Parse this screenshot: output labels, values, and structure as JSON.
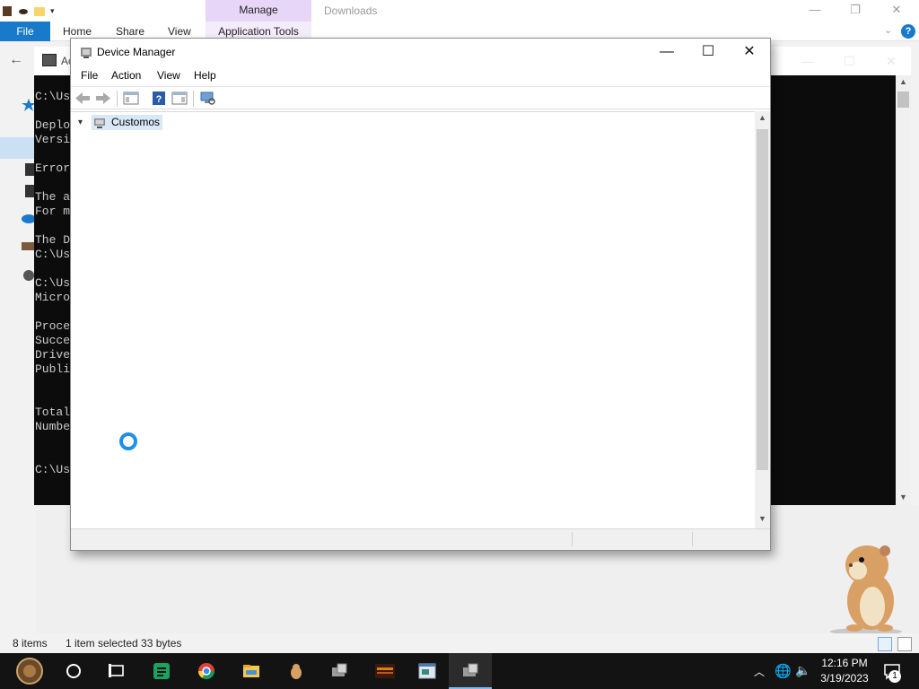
{
  "explorer": {
    "manage_tab": "Manage",
    "title": "Downloads",
    "ribbon": {
      "file": "File",
      "home": "Home",
      "share": "Share",
      "view": "View",
      "app_tools": "Application Tools"
    },
    "status": {
      "items": "8 items",
      "selected": "1 item selected  33 bytes"
    }
  },
  "console": {
    "title_prefix": "Ac",
    "lines": "C:\\Us\n\nDeplo\nVersi\n\nError\n\nThe a\nFor m\n\nThe D\nC:\\Us\n\nC:\\Us\nMicro\n\nProce\nSucce\nDrive\nPubli\n\n\nTotal\nNumbe\n\n\nC:\\Us"
  },
  "device_manager": {
    "title": "Device Manager",
    "menu": [
      "File",
      "Action",
      "View",
      "Help"
    ],
    "tree_root": "Customos",
    "buttons": {
      "minimize": "—",
      "maximize": "☐",
      "close": "✕"
    }
  },
  "taskbar": {
    "time": "12:16 PM",
    "date": "3/19/2023",
    "notification_count": "1"
  },
  "colors": {
    "accent": "#1979ca",
    "manage_tab": "#e7d6f7",
    "taskbar": "#131313",
    "selection": "#d9e8f7"
  }
}
